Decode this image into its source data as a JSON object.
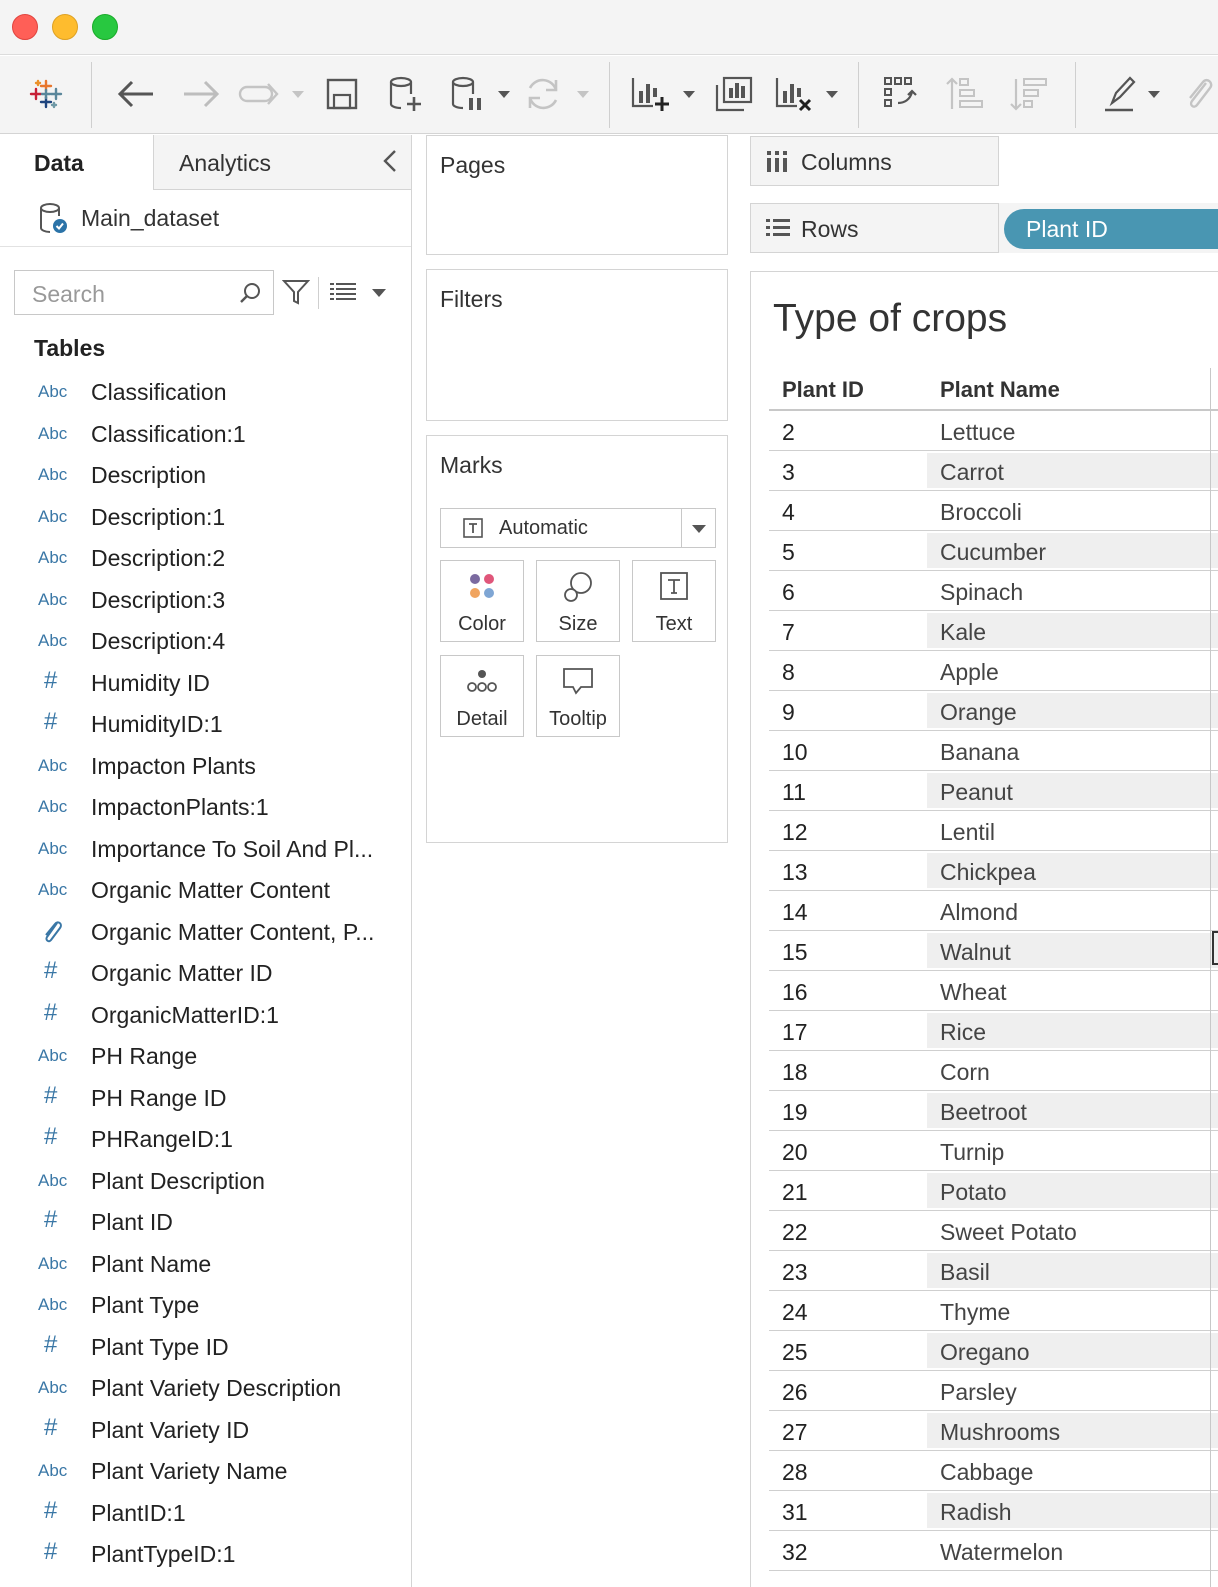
{
  "toolbar": {
    "icons": [
      "tableau-logo-icon",
      "back-icon",
      "forward-icon",
      "redo-icon",
      "save-icon",
      "new-datasource-icon",
      "pause-updates-icon",
      "refresh-icon",
      "new-worksheet-icon",
      "duplicate-sheet-icon",
      "clear-sheet-icon",
      "swap-icon",
      "sort-ascending-icon",
      "sort-descending-icon",
      "highlight-icon",
      "attachment-icon"
    ]
  },
  "left_pane": {
    "tab_data": "Data",
    "tab_analytics": "Analytics",
    "datasource": "Main_dataset",
    "search_placeholder": "Search",
    "tables_heading": "Tables",
    "fields": [
      {
        "type": "Abc",
        "name": "Classification"
      },
      {
        "type": "Abc",
        "name": "Classification:1"
      },
      {
        "type": "Abc",
        "name": "Description"
      },
      {
        "type": "Abc",
        "name": "Description:1"
      },
      {
        "type": "Abc",
        "name": "Description:2"
      },
      {
        "type": "Abc",
        "name": "Description:3"
      },
      {
        "type": "Abc",
        "name": "Description:4"
      },
      {
        "type": "#",
        "name": "Humidity ID"
      },
      {
        "type": "#",
        "name": "HumidityID:1"
      },
      {
        "type": "Abc",
        "name": "Impacton Plants"
      },
      {
        "type": "Abc",
        "name": "ImpactonPlants:1"
      },
      {
        "type": "Abc",
        "name": "Importance To Soil And Pl..."
      },
      {
        "type": "Abc",
        "name": "Organic Matter Content"
      },
      {
        "type": "clip",
        "name": "Organic Matter Content, P..."
      },
      {
        "type": "#",
        "name": "Organic Matter ID"
      },
      {
        "type": "#",
        "name": "OrganicMatterID:1"
      },
      {
        "type": "Abc",
        "name": "PH Range"
      },
      {
        "type": "#",
        "name": "PH Range ID"
      },
      {
        "type": "#",
        "name": "PHRangeID:1"
      },
      {
        "type": "Abc",
        "name": "Plant Description"
      },
      {
        "type": "#",
        "name": "Plant ID"
      },
      {
        "type": "Abc",
        "name": "Plant Name"
      },
      {
        "type": "Abc",
        "name": "Plant Type"
      },
      {
        "type": "#",
        "name": "Plant Type ID"
      },
      {
        "type": "Abc",
        "name": "Plant Variety Description"
      },
      {
        "type": "#",
        "name": "Plant Variety ID"
      },
      {
        "type": "Abc",
        "name": "Plant Variety Name"
      },
      {
        "type": "#",
        "name": "PlantID:1"
      },
      {
        "type": "#",
        "name": "PlantTypeID:1"
      }
    ]
  },
  "cards": {
    "pages": "Pages",
    "filters": "Filters",
    "marks": "Marks",
    "mark_type": "Automatic",
    "buttons": {
      "color": "Color",
      "size": "Size",
      "text": "Text",
      "detail": "Detail",
      "tooltip": "Tooltip"
    }
  },
  "shelves": {
    "columns": "Columns",
    "rows": "Rows",
    "rows_pill": "Plant ID"
  },
  "view": {
    "title": "Type of crops",
    "headers": [
      "Plant ID",
      "Plant Name"
    ],
    "rows": [
      {
        "id": "2",
        "name": "Lettuce"
      },
      {
        "id": "3",
        "name": "Carrot"
      },
      {
        "id": "4",
        "name": "Broccoli"
      },
      {
        "id": "5",
        "name": "Cucumber"
      },
      {
        "id": "6",
        "name": "Spinach"
      },
      {
        "id": "7",
        "name": "Kale"
      },
      {
        "id": "8",
        "name": "Apple"
      },
      {
        "id": "9",
        "name": "Orange"
      },
      {
        "id": "10",
        "name": "Banana"
      },
      {
        "id": "11",
        "name": "Peanut"
      },
      {
        "id": "12",
        "name": "Lentil"
      },
      {
        "id": "13",
        "name": "Chickpea"
      },
      {
        "id": "14",
        "name": "Almond"
      },
      {
        "id": "15",
        "name": "Walnut"
      },
      {
        "id": "16",
        "name": "Wheat"
      },
      {
        "id": "17",
        "name": "Rice"
      },
      {
        "id": "18",
        "name": "Corn"
      },
      {
        "id": "19",
        "name": "Beetroot"
      },
      {
        "id": "20",
        "name": "Turnip"
      },
      {
        "id": "21",
        "name": "Potato"
      },
      {
        "id": "22",
        "name": "Sweet Potato"
      },
      {
        "id": "23",
        "name": "Basil"
      },
      {
        "id": "24",
        "name": "Thyme"
      },
      {
        "id": "25",
        "name": "Oregano"
      },
      {
        "id": "26",
        "name": "Parsley"
      },
      {
        "id": "27",
        "name": "Mushrooms"
      },
      {
        "id": "28",
        "name": "Cabbage"
      },
      {
        "id": "31",
        "name": "Radish"
      },
      {
        "id": "32",
        "name": "Watermelon"
      }
    ]
  },
  "colors": {
    "pill": "#4996b2",
    "field_type": "#3a77a6",
    "close": "#ff5f57",
    "minimize": "#febc2e",
    "maximize": "#28c840"
  }
}
